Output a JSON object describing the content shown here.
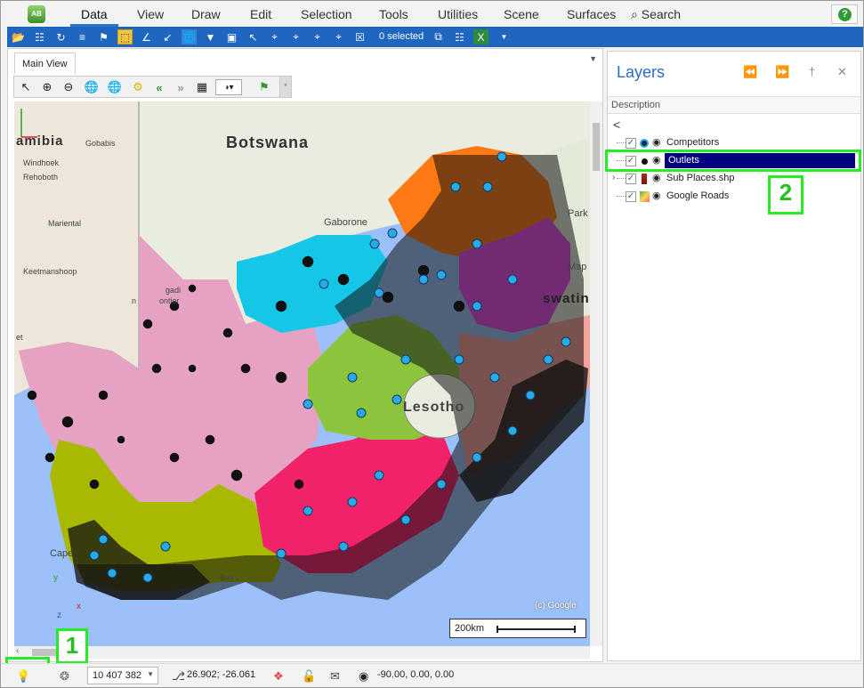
{
  "menu": {
    "items": [
      "Data",
      "View",
      "Draw",
      "Edit",
      "Selection",
      "Tools",
      "Utilities",
      "Scene",
      "Surfaces"
    ],
    "active": "Data",
    "search_label": "Search",
    "help_label": "?"
  },
  "toolbar": {
    "selected_count": "0 selected"
  },
  "map_view": {
    "tab_label": "Main View",
    "labels": {
      "botswana": "Botswana",
      "namibia": "amibia",
      "gobabis": "Gobabis",
      "windhoek": "Windhoek",
      "rehoboth": "Rehoboth",
      "mariental": "Mariental",
      "keetmanshoop": "Keetmanshoop",
      "gaborone": "Gaborone",
      "lesotho": "Lesotho",
      "eswatini": "swatini",
      "park": "Park",
      "map": "Map",
      "cape": "Cape",
      "bay": "Bay",
      "gadi": "gadi",
      "frontier": "ontier",
      "n_char": "n",
      "et": "et"
    },
    "scalebar_label": "200km",
    "attribution": "(c) Google",
    "axis_x": "x",
    "axis_y": "y",
    "axis_z": "z"
  },
  "layers_panel": {
    "title": "Layers",
    "column_header": "Description",
    "back_label": "<",
    "layers": [
      {
        "name": "Competitors",
        "checked": true,
        "visible": true,
        "selected": false,
        "icon": "point-layer-icon"
      },
      {
        "name": "Outlets",
        "checked": true,
        "visible": true,
        "selected": true,
        "icon": "point-layer-icon"
      },
      {
        "name": "Sub Places.shp",
        "checked": true,
        "visible": true,
        "selected": false,
        "icon": "polygon-layer-icon"
      },
      {
        "name": "Google Roads",
        "checked": true,
        "visible": true,
        "selected": false,
        "icon": "tile-layer-icon"
      }
    ]
  },
  "status": {
    "scale_value": "10 407 382",
    "coordinates": "26.902; -26.061",
    "orientation": "-90.00, 0.00, 0.00"
  },
  "annotations": [
    {
      "number": "1"
    },
    {
      "number": "2"
    }
  ],
  "colors": {
    "toolbar": "#1f66c1",
    "highlight": "#22ee22",
    "selection": "#000080",
    "layers_title": "#2b6cc4"
  }
}
